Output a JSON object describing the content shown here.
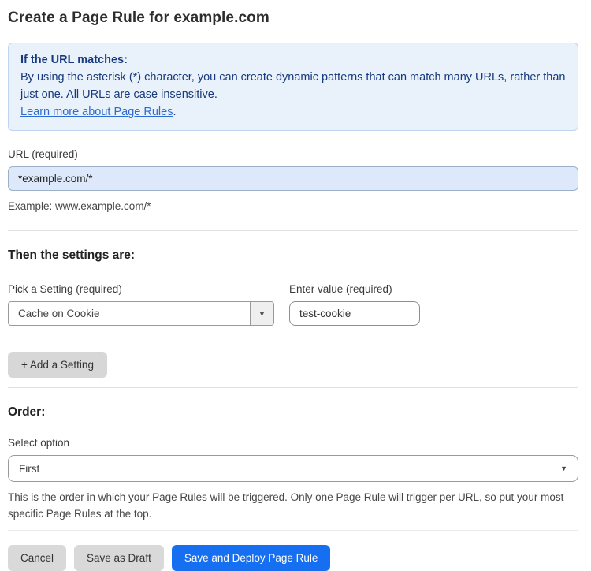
{
  "page": {
    "title": "Create a Page Rule for example.com"
  },
  "info_box": {
    "heading": "If the URL matches:",
    "body": "By using the asterisk (*) character, you can create dynamic patterns that can match many URLs, rather than just one. All URLs are case insensitive.",
    "link_label": "Learn more about Page Rules",
    "link_suffix": "."
  },
  "url_field": {
    "label": "URL (required)",
    "value": "*example.com/*",
    "helper": "Example: www.example.com/*"
  },
  "settings_section": {
    "heading": "Then the settings are:",
    "setting_select": {
      "label": "Pick a Setting (required)",
      "value": "Cache on Cookie",
      "arrow_icon": "▼"
    },
    "value_input": {
      "label": "Enter value (required)",
      "value": "test-cookie"
    },
    "add_setting_label": "+ Add a Setting"
  },
  "order_section": {
    "heading": "Order:",
    "select_label": "Select option",
    "select_value": "First",
    "arrow_icon": "▼",
    "helper": "This is the order in which your Page Rules will be triggered. Only one Page Rule will trigger per URL, so put your most specific Page Rules at the top."
  },
  "actions": {
    "cancel_label": "Cancel",
    "save_draft_label": "Save as Draft",
    "save_deploy_label": "Save and Deploy Page Rule"
  },
  "colors": {
    "primary_blue": "#156ff0",
    "info_box_bg": "#e9f1fb",
    "info_box_text": "#17397d",
    "link_blue": "#2e6bd0",
    "url_input_bg": "#dde9fa",
    "gray_button_bg": "#d9d9d9"
  }
}
